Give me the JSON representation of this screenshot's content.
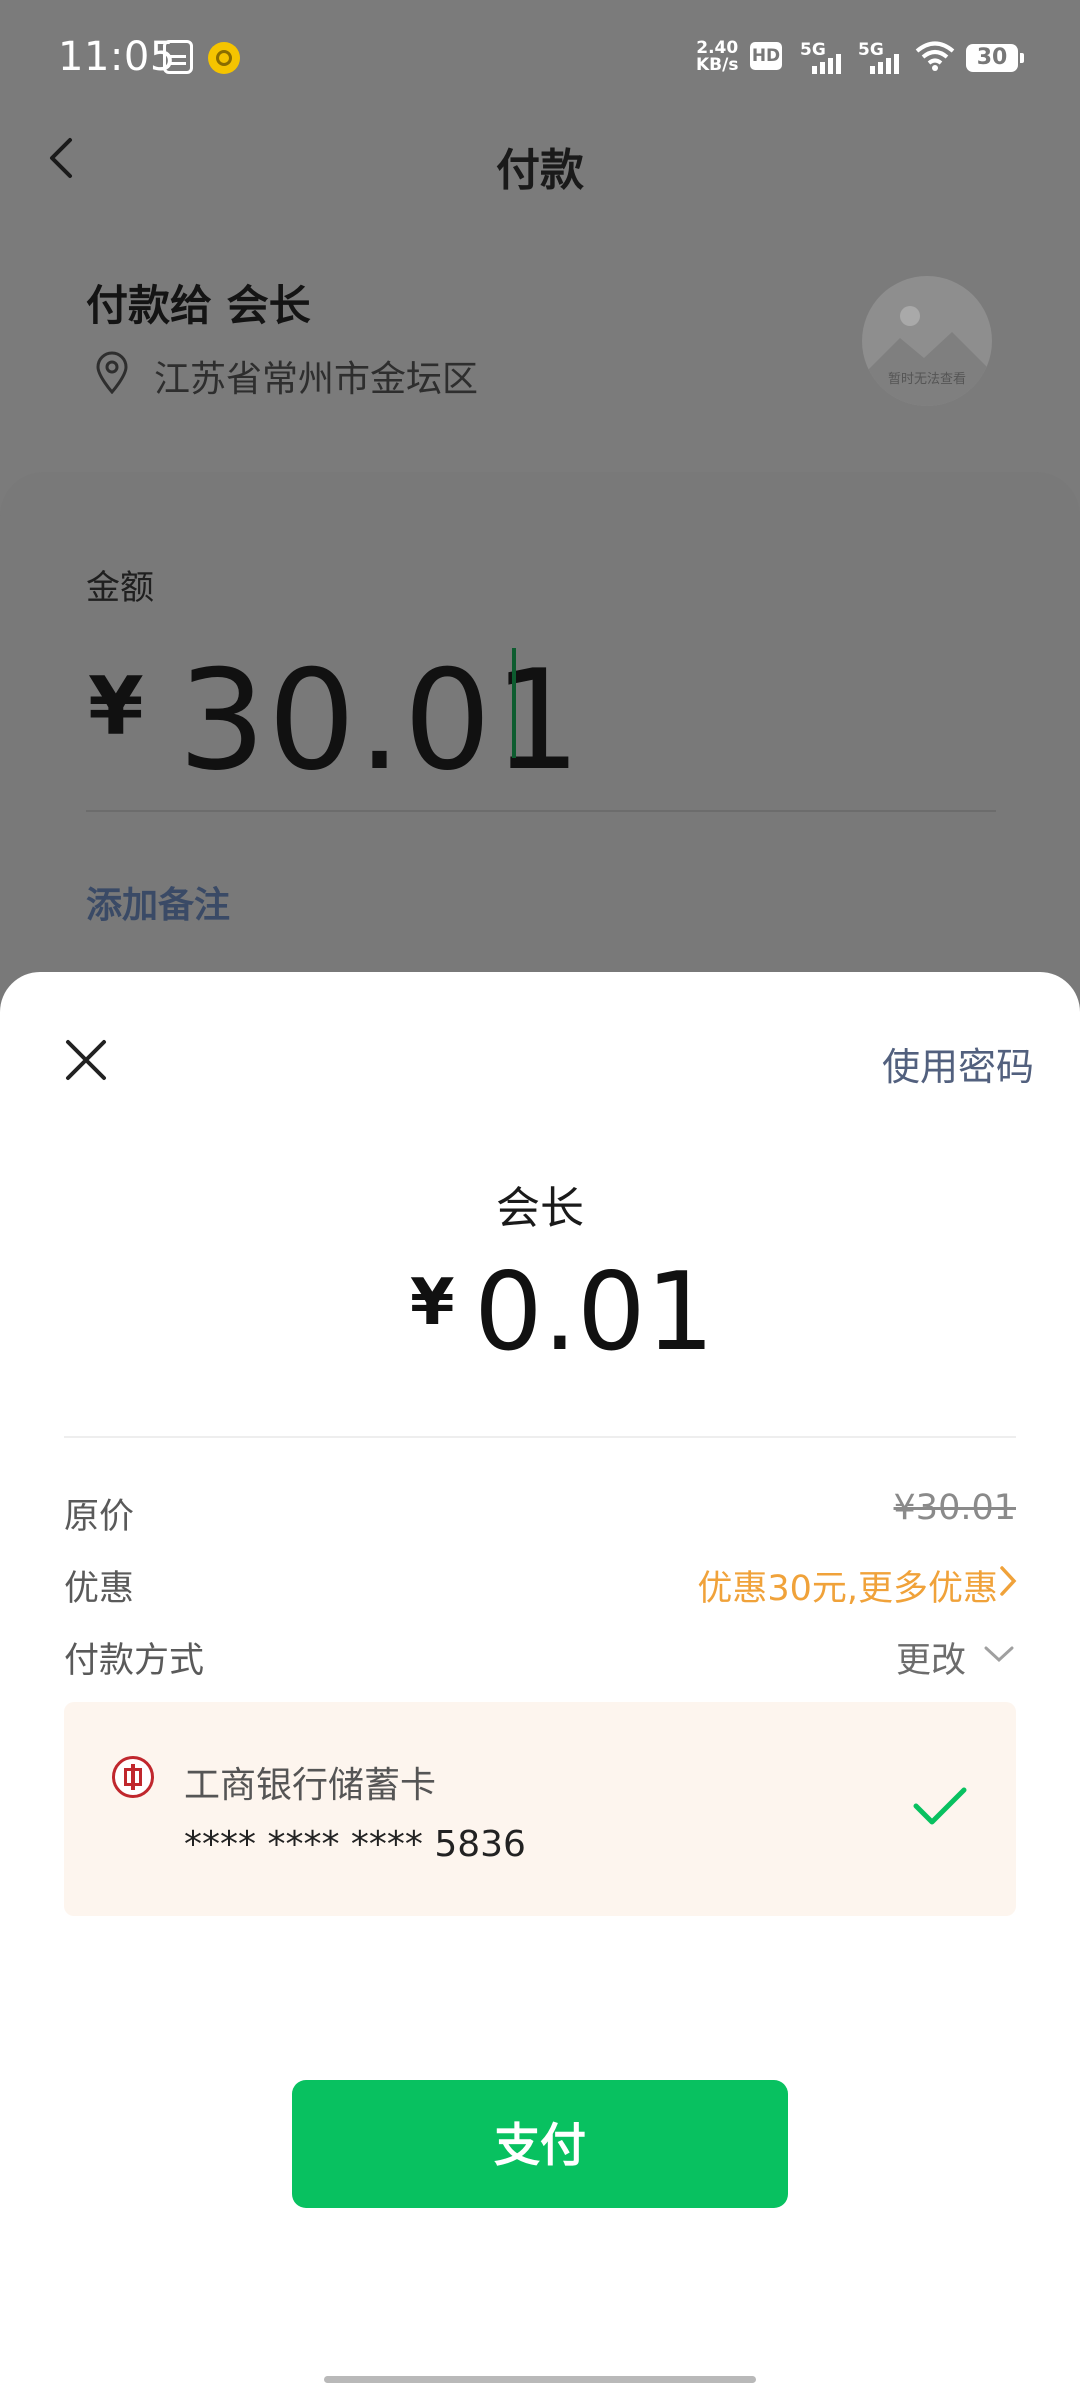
{
  "status_bar": {
    "time": "11:05",
    "net_speed_value": "2.40",
    "net_speed_unit": "KB/s",
    "hd_badge": "HD",
    "signal_1": "5G",
    "signal_2": "5G",
    "battery": "30"
  },
  "nav": {
    "title": "付款"
  },
  "payee": {
    "text": "付款给 会长",
    "location": "江苏省常州市金坛区",
    "avatar_caption": "暂时无法查看"
  },
  "amount": {
    "label": "金额",
    "symbol": "¥",
    "value": "30.01",
    "add_note": "添加备注"
  },
  "sheet": {
    "use_password": "使用密码",
    "payee_name": "会长",
    "symbol": "¥",
    "amount": "0.01",
    "original_price_label": "原价",
    "original_price_value": "¥30.01",
    "discount_label": "优惠",
    "discount_value": "优惠30元,更多优惠",
    "payment_method_label": "付款方式",
    "change_label": "更改",
    "card": {
      "bank_name": "工商银行储蓄卡",
      "number": "**** **** **** 5836"
    },
    "pay_button": "支付"
  },
  "colors": {
    "accent_green": "#08c160",
    "discount_orange": "#f0a23a",
    "link_blue": "#52607e",
    "bank_red": "#c0272d"
  },
  "icons": [
    "back-icon",
    "location-icon",
    "close-icon",
    "chevron-right-icon",
    "chevron-down-icon",
    "bank-icon",
    "check-icon",
    "wifi-icon",
    "battery-icon"
  ]
}
